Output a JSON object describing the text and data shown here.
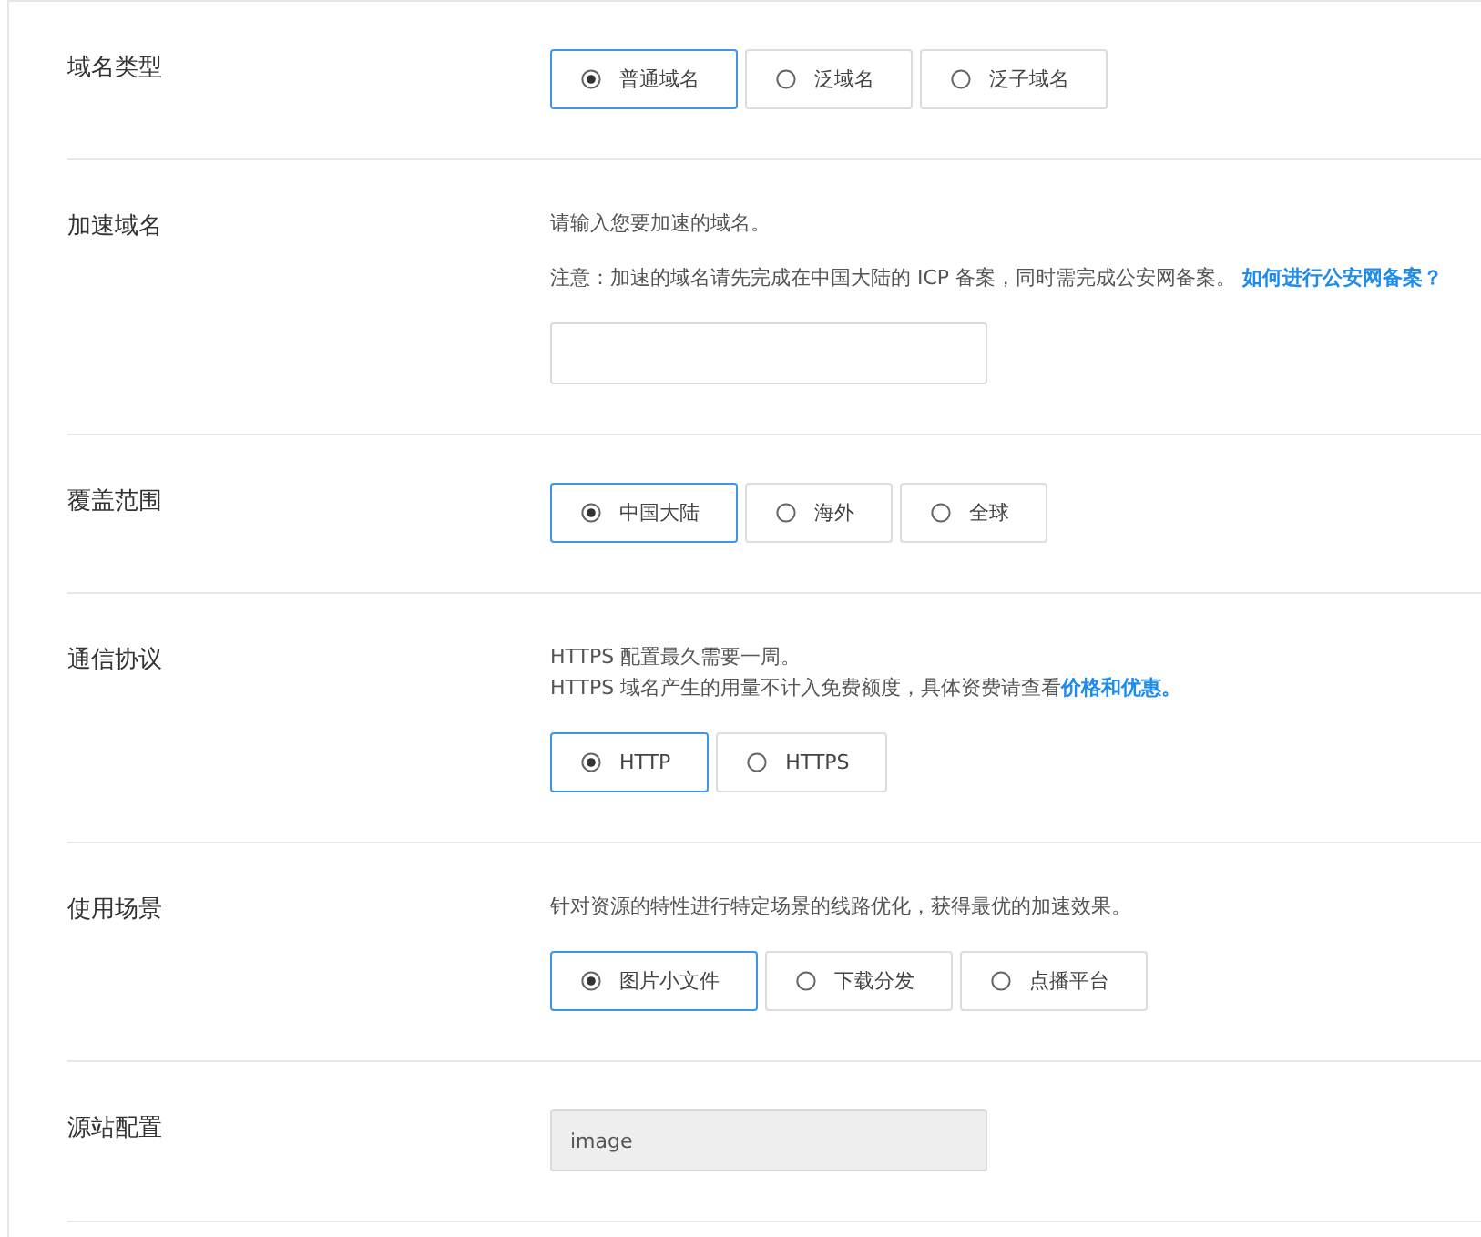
{
  "sections": [
    {
      "label": "域名类型",
      "control": {
        "kind": "radio",
        "options": [
          {
            "label": "普通域名",
            "selected": true
          },
          {
            "label": "泛域名",
            "selected": false
          },
          {
            "label": "泛子域名",
            "selected": false
          }
        ]
      }
    },
    {
      "label": "加速域名",
      "notes": [
        {
          "lines": [
            "请输入您要加速的域名。"
          ]
        },
        {
          "lines": [
            "注意：加速的域名请先完成在中国大陆的 ICP 备案，同时需完成公安网备案。 "
          ],
          "link": "如何进行公安网备案？"
        }
      ],
      "control": {
        "kind": "input",
        "disabled": false
      }
    },
    {
      "label": "覆盖范围",
      "control": {
        "kind": "radio",
        "options": [
          {
            "label": "中国大陆",
            "selected": true
          },
          {
            "label": "海外",
            "selected": false
          },
          {
            "label": "全球",
            "selected": false
          }
        ]
      }
    },
    {
      "label": "通信协议",
      "notes": [
        {
          "lines": [
            "HTTPS 配置最久需要一周。",
            "HTTPS 域名产生的用量不计入免费额度，具体资费请查看"
          ],
          "link": "价格和优惠。"
        }
      ],
      "control": {
        "kind": "radio",
        "options": [
          {
            "label": "HTTP",
            "selected": true
          },
          {
            "label": "HTTPS",
            "selected": false
          }
        ]
      }
    },
    {
      "label": "使用场景",
      "notes": [
        {
          "lines": [
            "针对资源的特性进行特定场景的线路优化，获得最优的加速效果。"
          ]
        }
      ],
      "control": {
        "kind": "radio",
        "options": [
          {
            "label": "图片小文件",
            "selected": true
          },
          {
            "label": "下载分发",
            "selected": false
          },
          {
            "label": "点播平台",
            "selected": false
          }
        ]
      }
    },
    {
      "label": "源站配置",
      "control": {
        "kind": "input",
        "disabled": true,
        "value": "image"
      }
    }
  ]
}
